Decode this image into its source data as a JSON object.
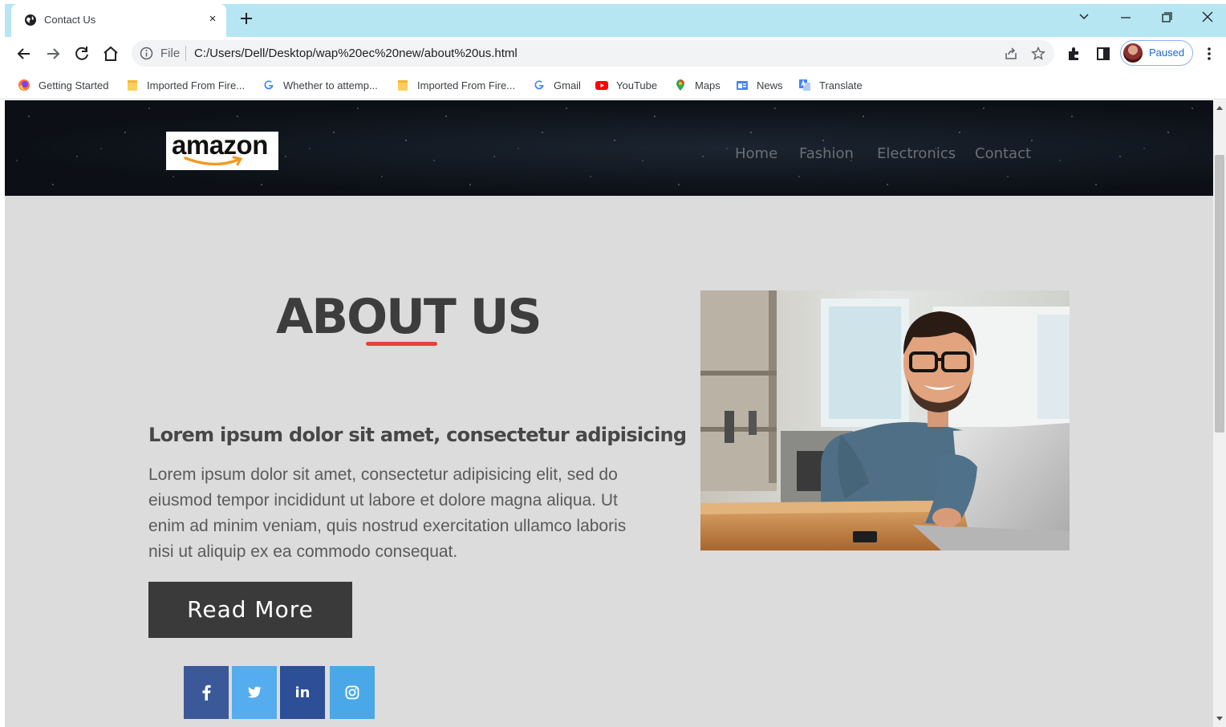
{
  "browser": {
    "tab": {
      "title": "Contact Us",
      "favicon": "globe-icon",
      "close": "×"
    },
    "new_tab": "+",
    "address": {
      "scheme_label": "File",
      "url": "C:/Users/Dell/Desktop/wap%20ec%20new/about%20us.html"
    },
    "profile": {
      "label": "Paused"
    },
    "bookmarks": [
      {
        "label": "Getting Started",
        "icon": "firefox-icon"
      },
      {
        "label": "Imported From Fire...",
        "icon": "folder-icon"
      },
      {
        "label": "Whether to attemp...",
        "icon": "google-icon"
      },
      {
        "label": "Imported From Fire...",
        "icon": "folder-icon"
      },
      {
        "label": "Gmail",
        "icon": "google-icon"
      },
      {
        "label": "YouTube",
        "icon": "youtube-icon"
      },
      {
        "label": "Maps",
        "icon": "maps-icon"
      },
      {
        "label": "News",
        "icon": "news-icon"
      },
      {
        "label": "Translate",
        "icon": "translate-icon"
      }
    ]
  },
  "site": {
    "logo_text": "amazon",
    "nav": [
      "Home",
      "Fashion",
      "Electronics",
      "Contact"
    ],
    "about": {
      "title": "ABOUT US",
      "accent_color": "#e8403a",
      "lead": "Lorem ipsum dolor sit amet, consectetur adipisicing",
      "body": "Lorem ipsum dolor sit amet, consectetur adipisicing elit, sed do eiusmod tempor incididunt ut labore et dolore magna aliqua. Ut enim ad minim veniam, quis nostrud exercitation ullamco laboris nisi ut aliquip ex ea commodo consequat.",
      "button": "Read More",
      "photo": "man-at-laptop-photo"
    },
    "social": [
      {
        "icon": "facebook-icon",
        "glyph": "f",
        "color": "#3b5998"
      },
      {
        "icon": "twitter-icon",
        "glyph": "t",
        "color": "#55acee"
      },
      {
        "icon": "linkedin-icon",
        "glyph": "in",
        "color": "#2d4f97"
      },
      {
        "icon": "instagram-icon",
        "glyph": "◎",
        "color": "#4aa8e8"
      }
    ]
  }
}
